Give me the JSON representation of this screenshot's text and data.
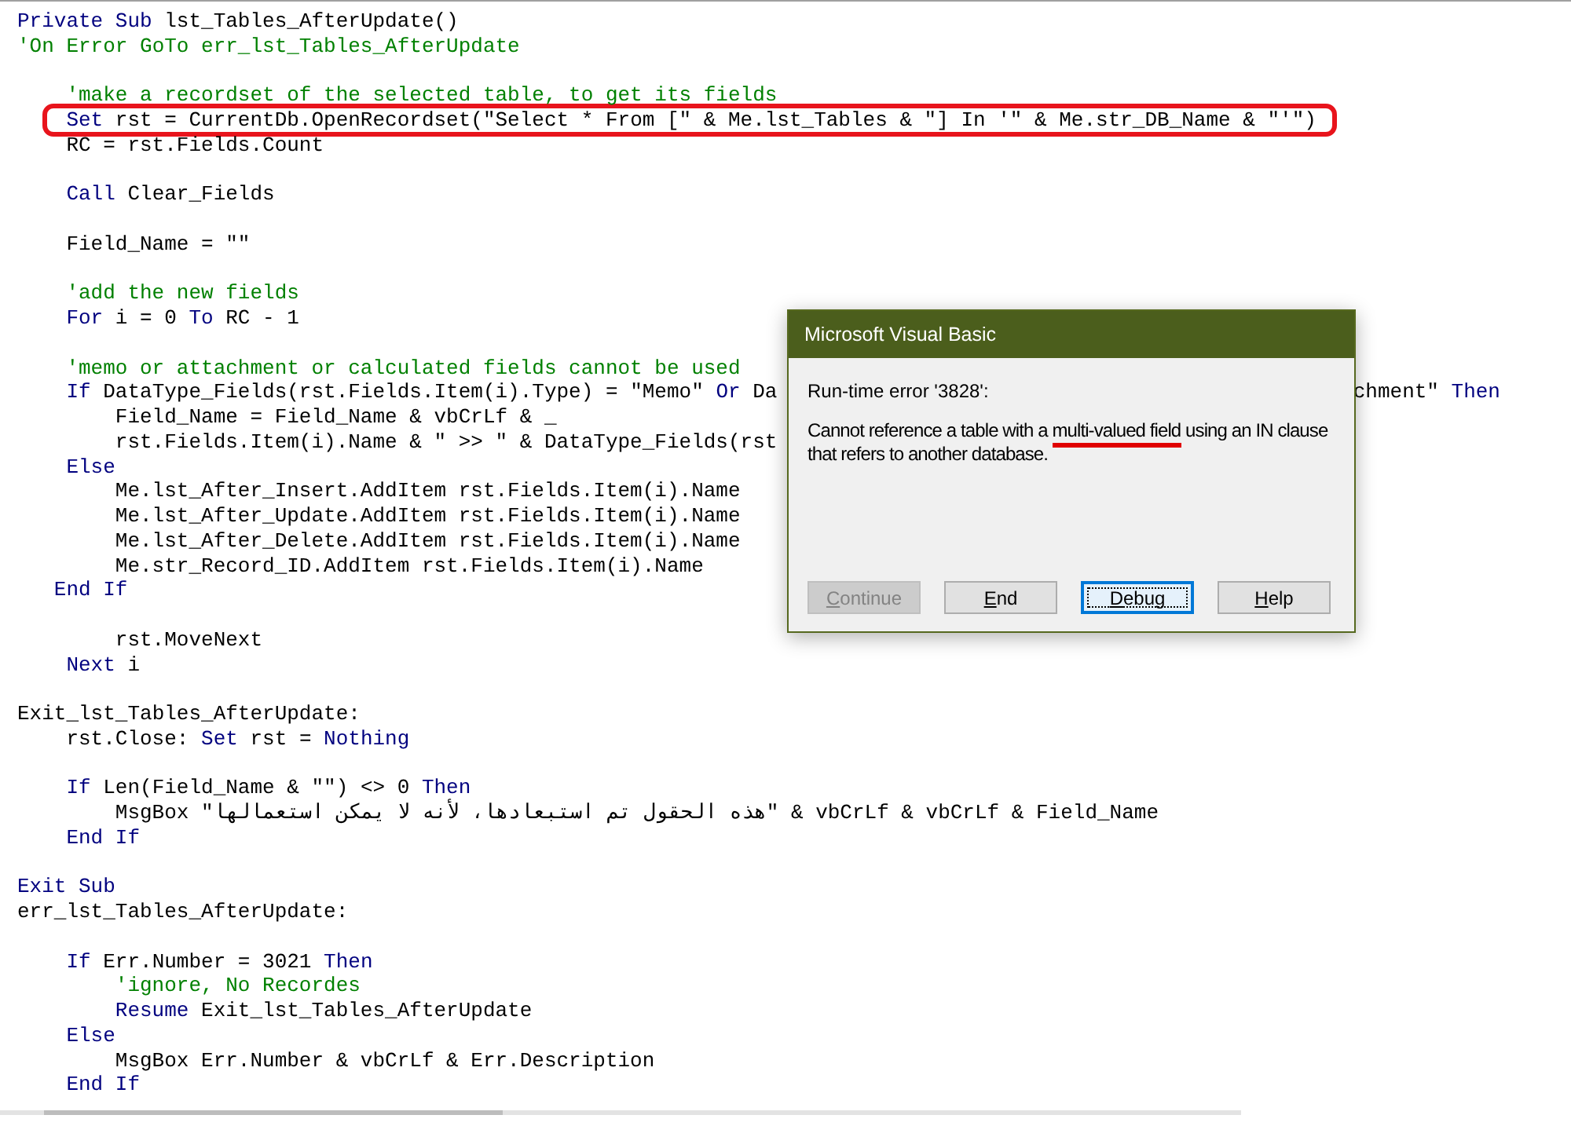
{
  "code_blocks": [
    {
      "lines": [
        {
          "highlighted": false,
          "tokens": [
            {
              "kind": "keyword",
              "text": "Private Sub"
            },
            {
              "kind": "plain",
              "text": " lst_Tables_AfterUpdate()"
            }
          ]
        },
        {
          "highlighted": false,
          "tokens": [
            {
              "kind": "comment",
              "text": "'On Error GoTo err_lst_Tables_AfterUpdate"
            }
          ]
        }
      ]
    },
    {
      "lines": [
        {
          "highlighted": false,
          "tokens": [
            {
              "kind": "comment",
              "text": "    'make a recordset of the selected table, to get its fields"
            }
          ]
        },
        {
          "highlighted": true,
          "tokens": [
            {
              "kind": "keyword",
              "text": "    Set"
            },
            {
              "kind": "plain",
              "text": " rst = CurrentDb.OpenRecordset(\"Select * From [\" & Me.lst_Tables & \"] In '\" & Me.str_DB_Name & \"'\")"
            }
          ]
        },
        {
          "highlighted": false,
          "tokens": [
            {
              "kind": "plain",
              "text": "    RC = rst.Fields.Count"
            }
          ]
        }
      ]
    },
    {
      "lines": [
        {
          "highlighted": false,
          "tokens": [
            {
              "kind": "keyword",
              "text": "    Call"
            },
            {
              "kind": "plain",
              "text": " Clear_Fields"
            }
          ]
        }
      ]
    },
    {
      "lines": [
        {
          "highlighted": false,
          "tokens": [
            {
              "kind": "plain",
              "text": "    Field_Name = \"\""
            }
          ]
        }
      ]
    },
    {
      "lines": [
        {
          "highlighted": false,
          "tokens": [
            {
              "kind": "comment",
              "text": "    'add the new fields"
            }
          ]
        },
        {
          "highlighted": false,
          "tokens": [
            {
              "kind": "keyword",
              "text": "    For"
            },
            {
              "kind": "plain",
              "text": " i = 0 "
            },
            {
              "kind": "keyword",
              "text": "To"
            },
            {
              "kind": "plain",
              "text": " RC - 1"
            }
          ]
        }
      ]
    },
    {
      "lines": [
        {
          "highlighted": false,
          "tokens": [
            {
              "kind": "comment",
              "text": "    'memo or attachment or calculated fields cannot be used"
            }
          ]
        },
        {
          "highlighted": false,
          "tokens": [
            {
              "kind": "keyword",
              "text": "    If"
            },
            {
              "kind": "plain",
              "text": " DataType_Fields(rst.Fields.Item(i).Type) = \"Memo\" "
            },
            {
              "kind": "keyword",
              "text": "Or"
            },
            {
              "kind": "plain",
              "text": " Da"
            }
          ],
          "tokens_right_of_dialog": [
            {
              "kind": "plain",
              "text": "chment\" "
            },
            {
              "kind": "keyword",
              "text": "Then"
            }
          ]
        },
        {
          "highlighted": false,
          "tokens": [
            {
              "kind": "plain",
              "text": "        Field_Name = Field_Name & vbCrLf & _"
            }
          ]
        },
        {
          "highlighted": false,
          "tokens": [
            {
              "kind": "plain",
              "text": "        rst.Fields.Item(i).Name & \" >> \" & DataType_Fields(rst"
            }
          ]
        },
        {
          "highlighted": false,
          "tokens": [
            {
              "kind": "keyword",
              "text": "    Else"
            }
          ]
        },
        {
          "highlighted": false,
          "tokens": [
            {
              "kind": "plain",
              "text": "        Me.lst_After_Insert.AddItem rst.Fields.Item(i).Name"
            }
          ]
        },
        {
          "highlighted": false,
          "tokens": [
            {
              "kind": "plain",
              "text": "        Me.lst_After_Update.AddItem rst.Fields.Item(i).Name"
            }
          ]
        },
        {
          "highlighted": false,
          "tokens": [
            {
              "kind": "plain",
              "text": "        Me.lst_After_Delete.AddItem rst.Fields.Item(i).Name"
            }
          ]
        },
        {
          "highlighted": false,
          "tokens": [
            {
              "kind": "plain",
              "text": "        Me.str_Record_ID.AddItem rst.Fields.Item(i).Name"
            }
          ]
        },
        {
          "highlighted": false,
          "tokens": [
            {
              "kind": "keyword",
              "text": "   End If"
            }
          ]
        }
      ]
    },
    {
      "lines": [
        {
          "highlighted": false,
          "tokens": [
            {
              "kind": "plain",
              "text": "        rst.MoveNext"
            }
          ]
        },
        {
          "highlighted": false,
          "tokens": [
            {
              "kind": "keyword",
              "text": "    Next"
            },
            {
              "kind": "plain",
              "text": " i"
            }
          ]
        }
      ]
    },
    {
      "lines": [
        {
          "highlighted": false,
          "tokens": [
            {
              "kind": "plain",
              "text": "Exit_lst_Tables_AfterUpdate:"
            }
          ]
        },
        {
          "highlighted": false,
          "tokens": [
            {
              "kind": "plain",
              "text": "    rst.Close: "
            },
            {
              "kind": "keyword",
              "text": "Set"
            },
            {
              "kind": "plain",
              "text": " rst = "
            },
            {
              "kind": "keyword",
              "text": "Nothing"
            }
          ]
        }
      ]
    },
    {
      "lines": [
        {
          "highlighted": false,
          "tokens": [
            {
              "kind": "keyword",
              "text": "    If"
            },
            {
              "kind": "plain",
              "text": " Len(Field_Name & \"\") <> 0 "
            },
            {
              "kind": "keyword",
              "text": "Then"
            }
          ]
        },
        {
          "highlighted": false,
          "tokens": [
            {
              "kind": "plain",
              "text": "        MsgBox \"هذه الحقول تم استبعادها، لأنه لا يمكن استعمالها\" & vbCrLf & vbCrLf & Field_Name"
            }
          ]
        },
        {
          "highlighted": false,
          "tokens": [
            {
              "kind": "keyword",
              "text": "    End If"
            }
          ]
        }
      ]
    },
    {
      "lines": [
        {
          "highlighted": false,
          "tokens": [
            {
              "kind": "keyword",
              "text": "Exit Sub"
            }
          ]
        },
        {
          "highlighted": false,
          "tokens": [
            {
              "kind": "plain",
              "text": "err_lst_Tables_AfterUpdate:"
            }
          ]
        }
      ]
    },
    {
      "lines": [
        {
          "highlighted": false,
          "tokens": [
            {
              "kind": "keyword",
              "text": "    If"
            },
            {
              "kind": "plain",
              "text": " Err.Number = 3021 "
            },
            {
              "kind": "keyword",
              "text": "Then"
            }
          ]
        },
        {
          "highlighted": false,
          "tokens": [
            {
              "kind": "comment",
              "text": "        'ignore, No Recordes"
            }
          ]
        },
        {
          "highlighted": false,
          "tokens": [
            {
              "kind": "keyword",
              "text": "        Resume"
            },
            {
              "kind": "plain",
              "text": " Exit_lst_Tables_AfterUpdate"
            }
          ]
        },
        {
          "highlighted": false,
          "tokens": [
            {
              "kind": "keyword",
              "text": "    Else"
            }
          ]
        },
        {
          "highlighted": false,
          "tokens": [
            {
              "kind": "plain",
              "text": "        MsgBox Err.Number & vbCrLf & Err.Description"
            }
          ]
        },
        {
          "highlighted": false,
          "tokens": [
            {
              "kind": "keyword",
              "text": "    End If"
            }
          ]
        }
      ]
    }
  ],
  "dialog": {
    "title": "Microsoft Visual Basic",
    "error": "Run-time error '3828':",
    "message_parts": [
      {
        "text": "Cannot reference a table with a ",
        "marked": false
      },
      {
        "text": "multi-valued field",
        "marked": true
      },
      {
        "text": " using an IN clause that refers to another database.",
        "marked": false
      }
    ],
    "buttons": [
      {
        "label": "Continue",
        "disabled": true,
        "focused": false
      },
      {
        "label": "End",
        "disabled": false,
        "focused": false
      },
      {
        "label": "Debug",
        "disabled": false,
        "focused": true
      },
      {
        "label": "Help",
        "disabled": false,
        "focused": false
      }
    ]
  }
}
